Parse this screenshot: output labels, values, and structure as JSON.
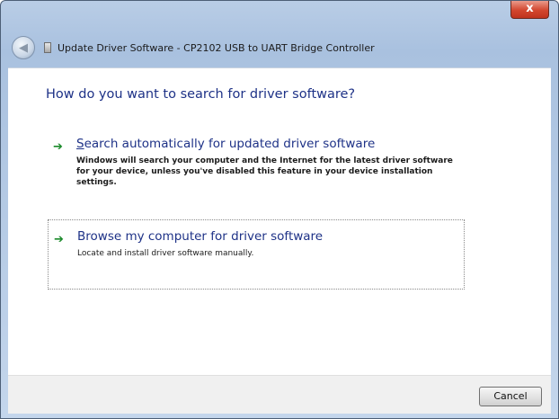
{
  "window": {
    "title": "Update Driver Software - CP2102 USB to UART Bridge Controller",
    "close_glyph": "x"
  },
  "nav": {
    "back_icon": "back-arrow-icon",
    "device_icon": "usb-device-icon"
  },
  "content": {
    "question": "How do you want to search for driver software?",
    "options": [
      {
        "title_mnemonic": "S",
        "title_rest": "earch automatically for updated driver software",
        "description": "Windows will search your computer and the Internet for the latest driver software for your device, unless you've disabled this feature in your device installation settings.",
        "icon": "green-arrow-icon"
      },
      {
        "title": "Browse my computer for driver software",
        "description": "Locate and install driver software manually.",
        "icon": "green-arrow-icon"
      }
    ]
  },
  "footer": {
    "cancel_label": "Cancel"
  },
  "colors": {
    "heading_blue": "#1e3287",
    "arrow_green": "#1b8a2a",
    "close_red": "#c0331e"
  }
}
